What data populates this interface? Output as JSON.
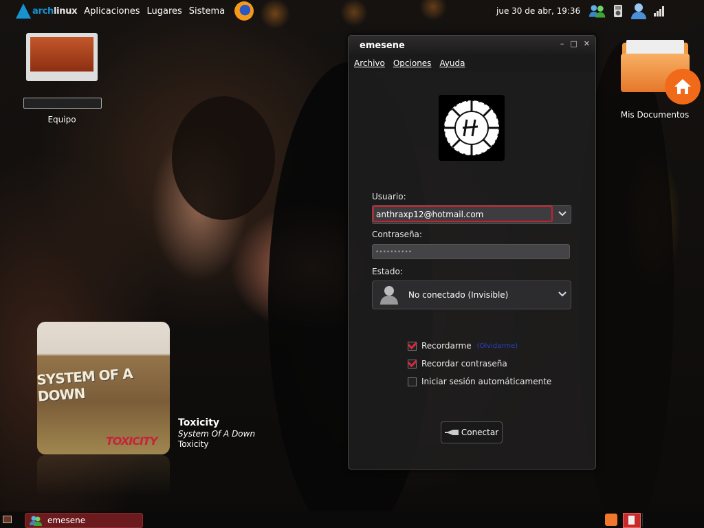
{
  "top_panel": {
    "brand_prefix": "arch",
    "brand_suffix": "linux",
    "menus": [
      "Aplicaciones",
      "Lugares",
      "Sistema"
    ],
    "clock": "jue 30 de abr, 19:36"
  },
  "desktop": {
    "icons": [
      {
        "label": "Equipo"
      },
      {
        "label": "Mis Documentos"
      }
    ]
  },
  "music_widget": {
    "album_art_text": "SYSTEM OF A DOWN",
    "album_art_subtext": "TOXICITY",
    "song_title": "Toxicity",
    "artist": "System Of A Down",
    "album": "Toxicity"
  },
  "window": {
    "title": "emesene",
    "controls": [
      "–",
      "□",
      "✕"
    ],
    "menubar": [
      "Archivo",
      "Opciones",
      "Ayuda"
    ],
    "user_label": "Usuario:",
    "user_value": "anthraxp12@hotmail.com",
    "password_label": "Contraseña:",
    "password_mask": "••••••••••",
    "status_label": "Estado:",
    "status_value": "No conectado (Invisible)",
    "remember_me": {
      "label": "Recordarme",
      "checked": true,
      "link": "(Olvidarme)"
    },
    "remember_password": {
      "label": "Recordar contraseña",
      "checked": true
    },
    "auto_login": {
      "label": "Iniciar sesión automáticamente",
      "checked": false
    },
    "connect_button": "Conectar"
  },
  "bottom_panel": {
    "task_label": "emesene"
  },
  "colors": {
    "accent_blue": "#1793d1",
    "focus_red": "#c3232d",
    "task_red": "#6b1b1e",
    "home_orange": "#f06a19"
  }
}
